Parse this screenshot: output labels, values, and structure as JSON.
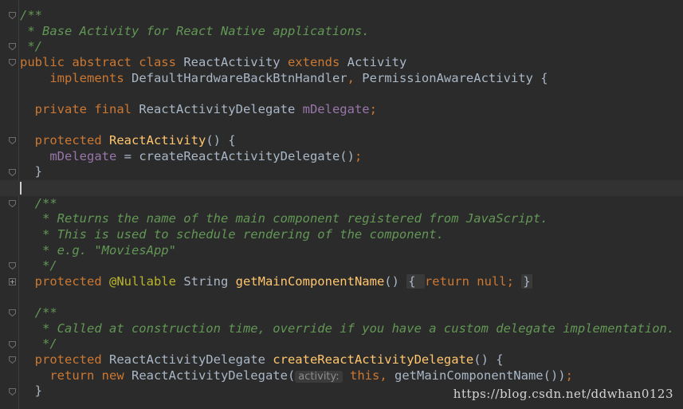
{
  "editor": {
    "lines": [
      {
        "tokens": [
          {
            "t": "/**",
            "c": "cm"
          }
        ]
      },
      {
        "tokens": [
          {
            "t": " * Base Activity for React Native applications.",
            "c": "cm"
          }
        ]
      },
      {
        "tokens": [
          {
            "t": " */",
            "c": "cm"
          }
        ]
      },
      {
        "tokens": [
          {
            "t": "public abstract class ",
            "c": "kw"
          },
          {
            "t": "ReactActivity ",
            "c": "cls"
          },
          {
            "t": "extends ",
            "c": "kw"
          },
          {
            "t": "Activity",
            "c": "cls"
          }
        ]
      },
      {
        "tokens": [
          {
            "t": "    implements ",
            "c": "kw"
          },
          {
            "t": "DefaultHardwareBackBtnHandler",
            "c": "cls"
          },
          {
            "t": ", ",
            "c": "kw"
          },
          {
            "t": "PermissionAwareActivity {",
            "c": "cls"
          }
        ]
      },
      {
        "tokens": []
      },
      {
        "tokens": [
          {
            "t": "  private final ",
            "c": "kw"
          },
          {
            "t": "ReactActivityDelegate ",
            "c": "cls"
          },
          {
            "t": "mDelegate",
            "c": "fld"
          },
          {
            "t": ";",
            "c": "kw"
          }
        ]
      },
      {
        "tokens": []
      },
      {
        "tokens": [
          {
            "t": "  protected ",
            "c": "kw"
          },
          {
            "t": "ReactActivity",
            "c": "fn"
          },
          {
            "t": "() {",
            "c": "cls"
          }
        ]
      },
      {
        "tokens": [
          {
            "t": "    ",
            "c": "cls"
          },
          {
            "t": "mDelegate",
            "c": "fld"
          },
          {
            "t": " = createReactActivityDelegate()",
            "c": "cls"
          },
          {
            "t": ";",
            "c": "kw"
          }
        ]
      },
      {
        "tokens": [
          {
            "t": "  }",
            "c": "cls"
          }
        ]
      },
      {
        "tokens": [],
        "current": true
      },
      {
        "tokens": [
          {
            "t": "  /**",
            "c": "cm"
          }
        ]
      },
      {
        "tokens": [
          {
            "t": "   * Returns the name of the main component registered from JavaScript.",
            "c": "cm"
          }
        ]
      },
      {
        "tokens": [
          {
            "t": "   * This is used to schedule rendering of the component.",
            "c": "cm"
          }
        ]
      },
      {
        "tokens": [
          {
            "t": "   * e.g. \"MoviesApp\"",
            "c": "cm"
          }
        ]
      },
      {
        "tokens": [
          {
            "t": "   */",
            "c": "cm"
          }
        ]
      },
      {
        "tokens": [
          {
            "t": "  protected ",
            "c": "kw"
          },
          {
            "t": "@Nullable ",
            "c": "ann"
          },
          {
            "t": "String ",
            "c": "cls"
          },
          {
            "t": "getMainComponentName",
            "c": "fn"
          },
          {
            "t": "() ",
            "c": "cls"
          },
          {
            "t": "{ ",
            "c": "cls folded"
          },
          {
            "t": "return null",
            "c": "kw"
          },
          {
            "t": "; ",
            "c": "kw"
          },
          {
            "t": "}",
            "c": "cls folded"
          }
        ]
      },
      {
        "tokens": []
      },
      {
        "tokens": [
          {
            "t": "  /**",
            "c": "cm"
          }
        ]
      },
      {
        "tokens": [
          {
            "t": "   * Called at construction time, override if you have a custom delegate implementation.",
            "c": "cm"
          }
        ]
      },
      {
        "tokens": [
          {
            "t": "   */",
            "c": "cm"
          }
        ]
      },
      {
        "tokens": [
          {
            "t": "  protected ",
            "c": "kw"
          },
          {
            "t": "ReactActivityDelegate ",
            "c": "cls"
          },
          {
            "t": "createReactActivityDelegate",
            "c": "fn"
          },
          {
            "t": "() {",
            "c": "cls"
          }
        ]
      },
      {
        "tokens": [
          {
            "t": "    return new ",
            "c": "kw"
          },
          {
            "t": "ReactActivityDelegate(",
            "c": "cls"
          },
          {
            "t": "activity:",
            "c": "hint"
          },
          {
            "t": " this",
            "c": "kw"
          },
          {
            "t": ", ",
            "c": "kw"
          },
          {
            "t": "getMainComponentName())",
            "c": "cls"
          },
          {
            "t": ";",
            "c": "kw"
          }
        ]
      },
      {
        "tokens": [
          {
            "t": "  }",
            "c": "cls"
          }
        ]
      }
    ]
  },
  "watermark": "https://blog.csdn.net/ddwhan0123"
}
